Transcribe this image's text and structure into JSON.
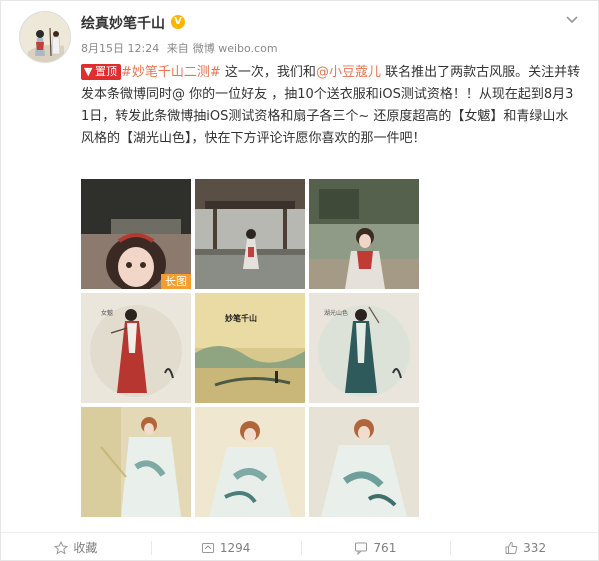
{
  "user": {
    "name": "绘真妙笔千山",
    "verified_mark": "V"
  },
  "meta": {
    "date": "8月15日 12:24",
    "source_prefix": "来自",
    "source": "微博 weibo.com"
  },
  "post": {
    "pin_label": "置顶",
    "hashtag": "#妙笔千山二测#",
    "text_1": " 这一次，我们和",
    "mention": "@小豆蔻儿",
    "text_2": " 联名推出了两款古风服。关注并转发本条微博同时@ 你的一位好友 ，抽10个送衣服和iOS测试资格！！从现在起到8月31日，转发此条微博抽iOS测试资格和扇子各三个~ 还原度超高的【女魃】和青绿山水风格的【湖光山色】，快在下方评论许愿你喜欢的那一件吧！"
  },
  "images": {
    "long_image_label": "长图",
    "calligraphy_1": "女魃",
    "calligraphy_2": "妙笔千山",
    "calligraphy_3": "湖光山色"
  },
  "actions": {
    "favorite": "收藏",
    "repost_count": "1294",
    "comment_count": "761",
    "like_count": "332"
  },
  "colors": {
    "link": "#eb7350",
    "pin": "#e02d2d",
    "verified": "#ffb400",
    "long_badge": "#f49d2c"
  }
}
